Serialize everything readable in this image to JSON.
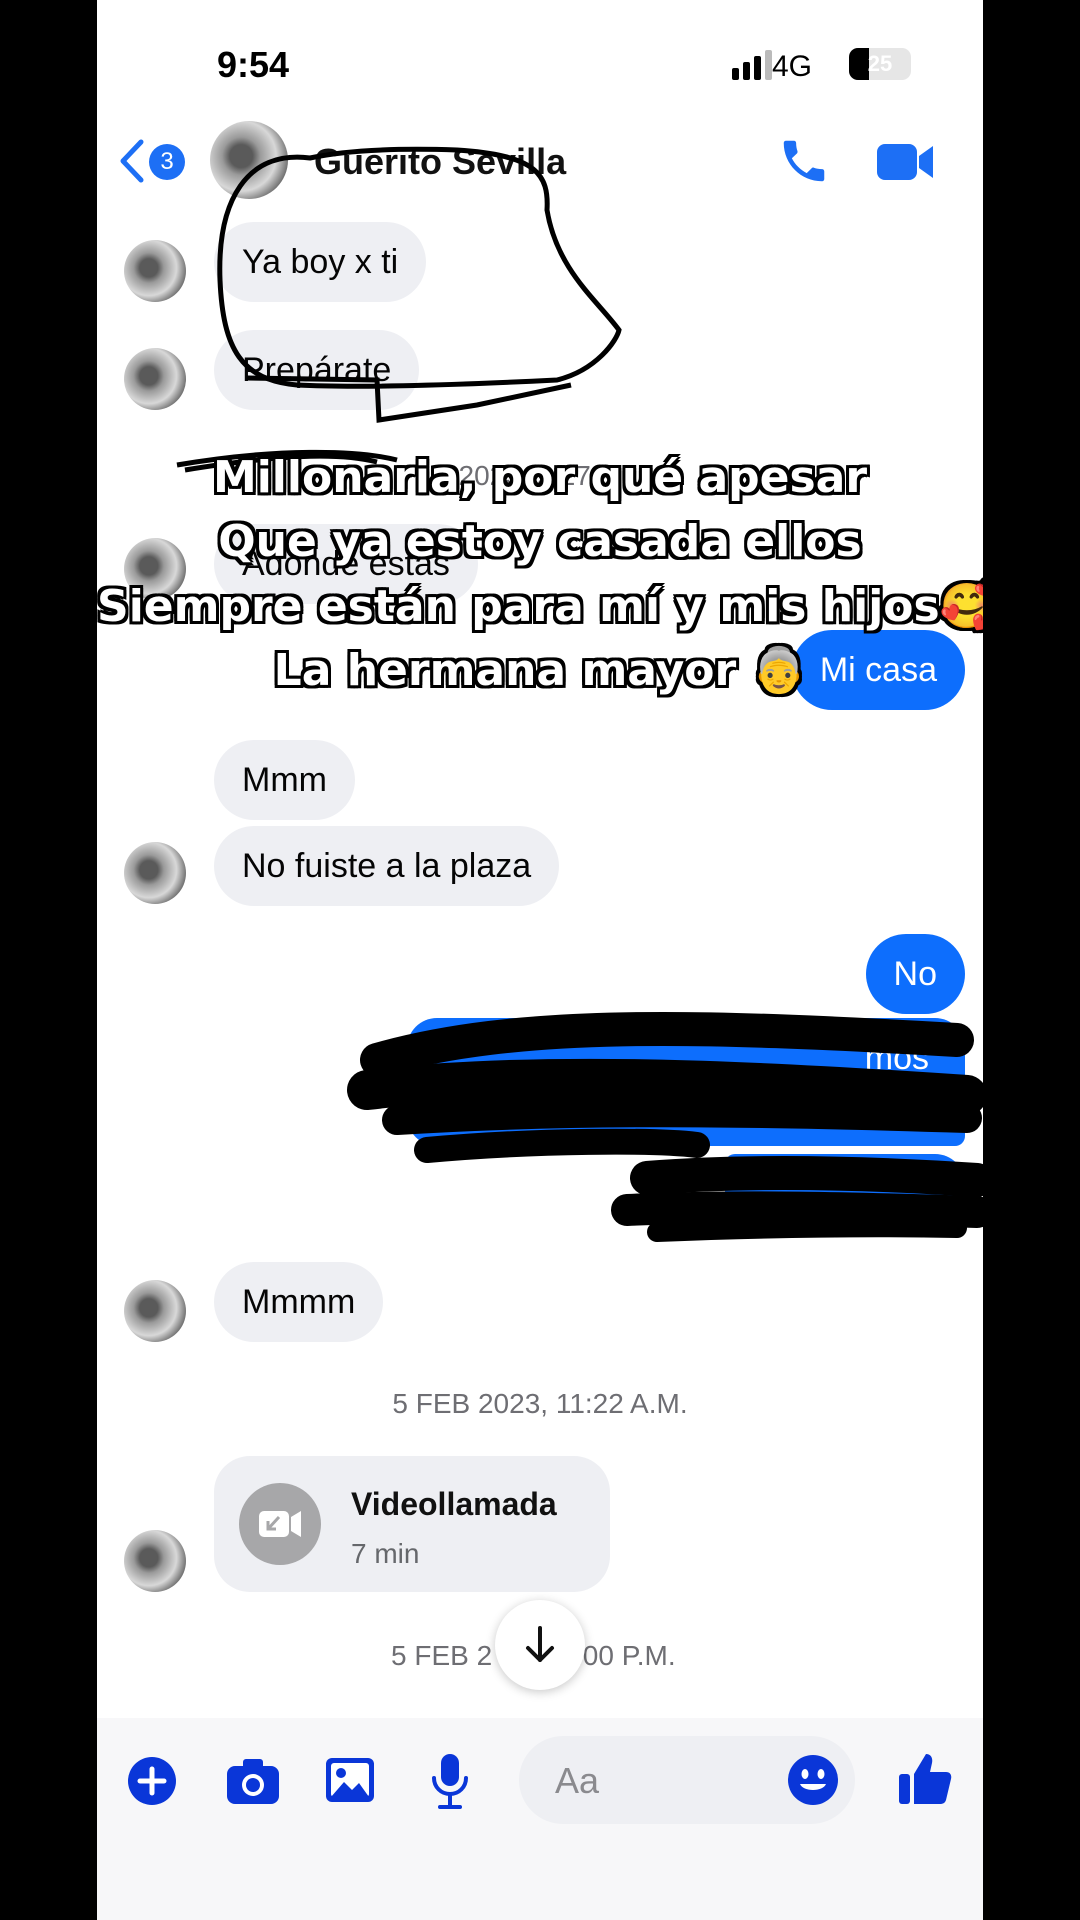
{
  "status_bar": {
    "time": "9:54",
    "network": "4G",
    "battery": "25"
  },
  "header": {
    "back_count": "3",
    "contact_name": "Guerito Sevilla"
  },
  "messages": {
    "m1": "Ya boy x ti",
    "m2": "Prepárate",
    "m3_partial": "Adonde estas",
    "m4": "Mi casa",
    "m5": "Mmm",
    "m6": "No fuiste a la plaza",
    "m7": "No",
    "m8_partial": "mos",
    "m9": "Mmmm"
  },
  "timestamps": {
    "t1_partial": "2023, 2:27 P.",
    "t2": "5 FEB 2023, 11:22 A.M.",
    "t3_left": "5 FEB 2",
    "t3_right": ":00 P.M."
  },
  "video_call": {
    "title": "Videollamada",
    "duration": "7 min"
  },
  "composer": {
    "placeholder": "Aa"
  },
  "overlay_caption": {
    "line1": "Millonaria, por qué apesar",
    "line2": "Que ya estoy casada ellos",
    "line3": "Siempre están para mí y mis hijos🥰",
    "line4": "La hermana mayor 👵"
  },
  "colors": {
    "accent": "#0d6efd",
    "composer_icons": "#0a36d8",
    "incoming_bubble": "#eeeff3"
  },
  "icons": [
    "back-chevron-icon",
    "phone-icon",
    "video-camera-icon",
    "plus-icon",
    "camera-icon",
    "image-icon",
    "microphone-icon",
    "emoji-icon",
    "thumbs-up-icon",
    "arrow-down-icon",
    "missed-video-call-icon"
  ]
}
